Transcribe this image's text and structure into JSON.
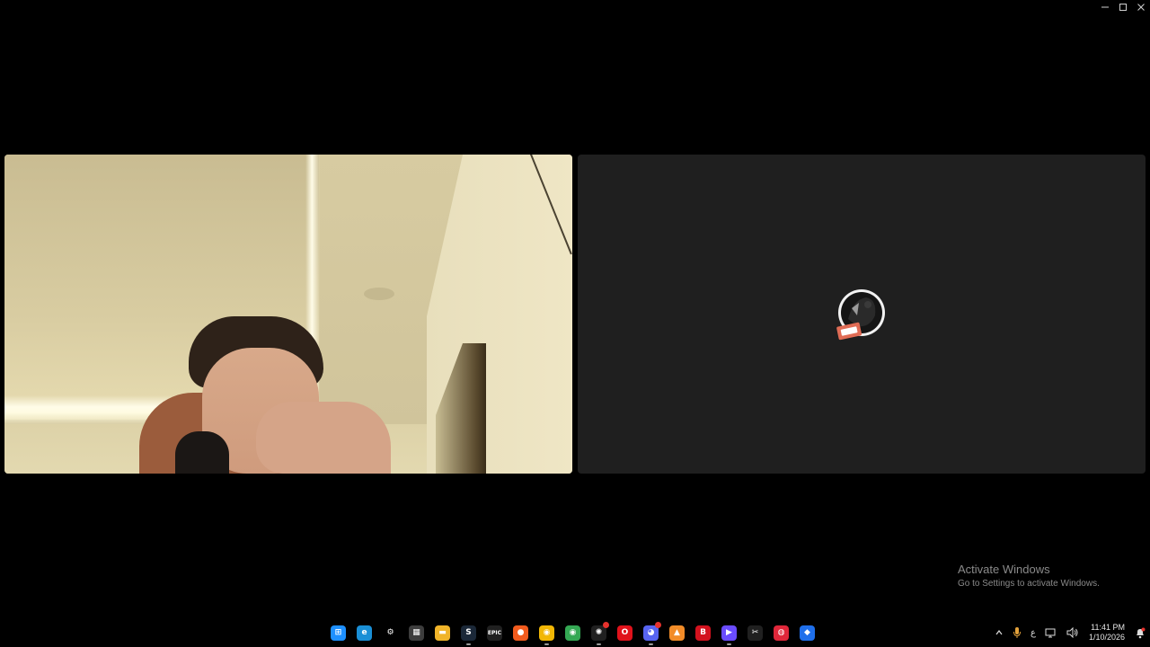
{
  "window": {
    "minimize_icon": "minimize-icon",
    "maximize_icon": "maximize-icon",
    "close_icon": "close-icon"
  },
  "tiles": {
    "left": {
      "kind": "camera-feed"
    },
    "right": {
      "kind": "avatar",
      "background": "#1f1f1f"
    }
  },
  "watermark": {
    "title": "Activate Windows",
    "subtitle": "Go to Settings to activate Windows."
  },
  "taskbar": {
    "apps": [
      {
        "icon": "windows-start-icon",
        "label": "⊞",
        "color": "#1e90ff"
      },
      {
        "icon": "edge-icon",
        "label": "e",
        "color": "#1a8fd6"
      },
      {
        "icon": "steelseries-icon",
        "label": "⚙",
        "color": "#000000"
      },
      {
        "icon": "microsoft-store-icon",
        "label": "▦",
        "color": "#3d3d3d"
      },
      {
        "icon": "file-explorer-icon",
        "label": "▬",
        "color": "#f0b429"
      },
      {
        "icon": "steam-icon",
        "label": "S",
        "color": "#1b2838"
      },
      {
        "icon": "epic-games-icon",
        "label": "EPIC",
        "color": "#202020"
      },
      {
        "icon": "origin-icon",
        "label": "●",
        "color": "#f25b1d"
      },
      {
        "icon": "chrome-icon",
        "label": "◉",
        "color": "#f2b705"
      },
      {
        "icon": "chrome-alt-icon",
        "label": "◉",
        "color": "#34a853"
      },
      {
        "icon": "chatgpt-icon",
        "label": "✺",
        "color": "#202020"
      },
      {
        "icon": "opera-icon",
        "label": "O",
        "color": "#e0121b"
      },
      {
        "icon": "discord-icon",
        "label": "◕",
        "color": "#5865f2"
      },
      {
        "icon": "orange-app-icon",
        "label": "▲",
        "color": "#f28c28"
      },
      {
        "icon": "red-app-icon",
        "label": "B",
        "color": "#d3121e"
      },
      {
        "icon": "media-player-icon",
        "label": "▶",
        "color": "#6a4cff"
      },
      {
        "icon": "capcut-icon",
        "label": "✂",
        "color": "#202020"
      },
      {
        "icon": "red-circle-app-icon",
        "label": "◍",
        "color": "#e0273a"
      },
      {
        "icon": "blue-app-icon",
        "label": "◆",
        "color": "#1f6feb"
      }
    ],
    "tray": {
      "chevron_icon": "chevron-up-icon",
      "mic_icon": "microphone-icon",
      "language": "ع",
      "network_icon": "network-icon",
      "volume_icon": "volume-icon",
      "time": "11:41 PM",
      "date": "1/10/2026",
      "notification_icon": "notification-bell-icon"
    }
  }
}
